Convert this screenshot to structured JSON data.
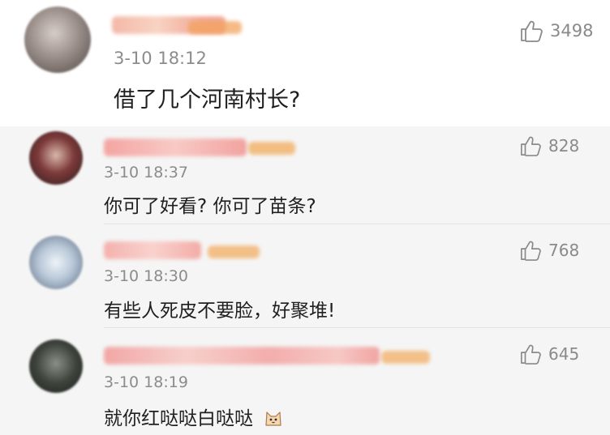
{
  "main_comment": {
    "time": "3-10 18:12",
    "text": "借了几个河南村长?",
    "likes": "3498"
  },
  "replies": [
    {
      "time": "3-10 18:37",
      "text": "你可了好看? 你可了苗条?",
      "likes": "828"
    },
    {
      "time": "3-10 18:30",
      "text": "有些人死皮不要脸，好聚堆!",
      "likes": "768"
    },
    {
      "time": "3-10 18:19",
      "text": "就你红哒哒白哒哒",
      "likes": "645",
      "emoji": "cat-face-emoji"
    }
  ],
  "icons": {
    "like": "thumbs-up-icon"
  },
  "colors": {
    "reply_background": "#f5f5f5",
    "meta_gray": "#8c8c8c"
  }
}
